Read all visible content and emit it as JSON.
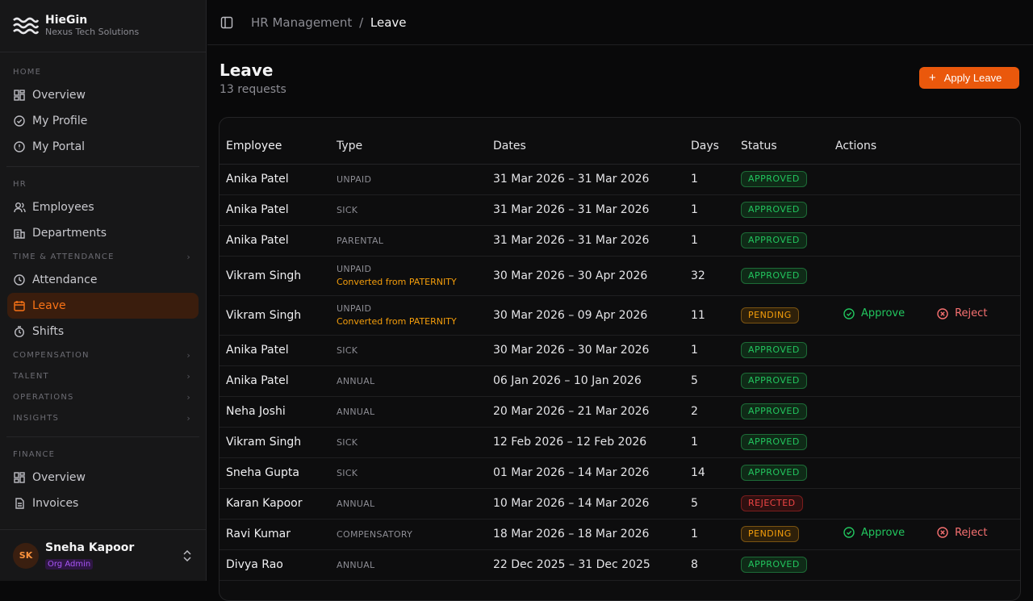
{
  "brand": {
    "name": "HieGin",
    "subtitle": "Nexus Tech Solutions"
  },
  "sidebar": {
    "home_label": "HOME",
    "home_items": [
      {
        "label": "Overview",
        "icon": "dashboard-icon"
      },
      {
        "label": "My Profile",
        "icon": "check-circle-icon"
      },
      {
        "label": "My Portal",
        "icon": "info-circle-icon"
      }
    ],
    "hr_label": "HR",
    "hr_items": [
      {
        "label": "Employees",
        "icon": "users-icon"
      },
      {
        "label": "Departments",
        "icon": "building-icon"
      }
    ],
    "time_label": "TIME & ATTENDANCE",
    "time_items": [
      {
        "label": "Attendance",
        "icon": "clock-icon"
      },
      {
        "label": "Leave",
        "icon": "calendar-icon"
      },
      {
        "label": "Shifts",
        "icon": "timer-icon"
      }
    ],
    "collapsed_sections": [
      "COMPENSATION",
      "TALENT",
      "OPERATIONS",
      "INSIGHTS"
    ],
    "finance_label": "FINANCE",
    "finance_items": [
      {
        "label": "Overview",
        "icon": "dashboard-icon"
      },
      {
        "label": "Invoices",
        "icon": "document-icon"
      }
    ]
  },
  "user": {
    "initials": "SK",
    "name": "Sneha Kapoor",
    "role": "Org Admin"
  },
  "breadcrumb": {
    "parent": "HR Management",
    "separator": "/",
    "current": "Leave"
  },
  "page": {
    "title": "Leave",
    "subtitle": "13 requests",
    "apply_label": "Apply Leave"
  },
  "table": {
    "headers": [
      "Employee",
      "Type",
      "Dates",
      "Days",
      "Status",
      "Actions"
    ],
    "rows": [
      {
        "employee": "Anika Patel",
        "type": "UNPAID",
        "note": "",
        "dates": "31 Mar 2026 – 31 Mar 2026",
        "days": "1",
        "status": "APPROVED"
      },
      {
        "employee": "Anika Patel",
        "type": "SICK",
        "note": "",
        "dates": "31 Mar 2026 – 31 Mar 2026",
        "days": "1",
        "status": "APPROVED"
      },
      {
        "employee": "Anika Patel",
        "type": "PARENTAL",
        "note": "",
        "dates": "31 Mar 2026 – 31 Mar 2026",
        "days": "1",
        "status": "APPROVED"
      },
      {
        "employee": "Vikram Singh",
        "type": "UNPAID",
        "note": "Converted from PATERNITY",
        "dates": "30 Mar 2026 – 30 Apr 2026",
        "days": "32",
        "status": "APPROVED"
      },
      {
        "employee": "Vikram Singh",
        "type": "UNPAID",
        "note": "Converted from PATERNITY",
        "dates": "30 Mar 2026 – 09 Apr 2026",
        "days": "11",
        "status": "PENDING"
      },
      {
        "employee": "Anika Patel",
        "type": "SICK",
        "note": "",
        "dates": "30 Mar 2026 – 30 Mar 2026",
        "days": "1",
        "status": "APPROVED"
      },
      {
        "employee": "Anika Patel",
        "type": "ANNUAL",
        "note": "",
        "dates": "06 Jan 2026 – 10 Jan 2026",
        "days": "5",
        "status": "APPROVED"
      },
      {
        "employee": "Neha Joshi",
        "type": "ANNUAL",
        "note": "",
        "dates": "20 Mar 2026 – 21 Mar 2026",
        "days": "2",
        "status": "APPROVED"
      },
      {
        "employee": "Vikram Singh",
        "type": "SICK",
        "note": "",
        "dates": "12 Feb 2026 – 12 Feb 2026",
        "days": "1",
        "status": "APPROVED"
      },
      {
        "employee": "Sneha Gupta",
        "type": "SICK",
        "note": "",
        "dates": "01 Mar 2026 – 14 Mar 2026",
        "days": "14",
        "status": "APPROVED"
      },
      {
        "employee": "Karan Kapoor",
        "type": "ANNUAL",
        "note": "",
        "dates": "10 Mar 2026 – 14 Mar 2026",
        "days": "5",
        "status": "REJECTED"
      },
      {
        "employee": "Ravi Kumar",
        "type": "COMPENSATORY",
        "note": "",
        "dates": "18 Mar 2026 – 18 Mar 2026",
        "days": "1",
        "status": "PENDING"
      },
      {
        "employee": "Divya Rao",
        "type": "ANNUAL",
        "note": "",
        "dates": "22 Dec 2025 – 31 Dec 2025",
        "days": "8",
        "status": "APPROVED"
      }
    ],
    "approve_label": "Approve",
    "reject_label": "Reject"
  },
  "colors": {
    "accent": "#ea580c",
    "approved": "#22c55e",
    "pending": "#f59e0b",
    "rejected": "#ef4444"
  }
}
